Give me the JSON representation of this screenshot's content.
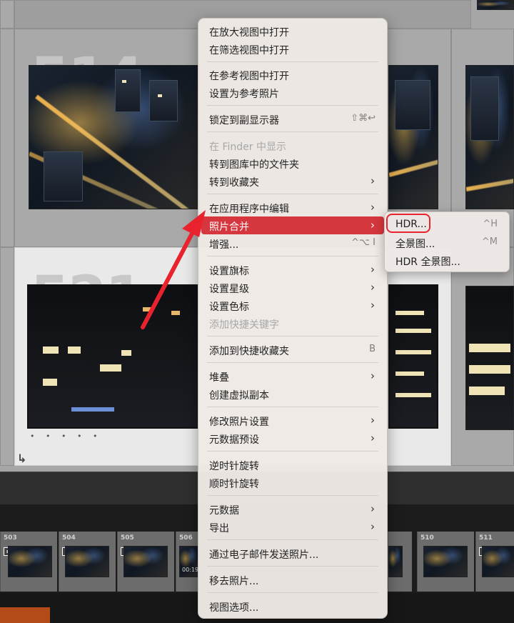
{
  "grid": {
    "cells": [
      {
        "number": "514"
      },
      {
        "number": "521"
      }
    ]
  },
  "filmstrip": {
    "cells": [
      {
        "number": "503"
      },
      {
        "number": "504"
      },
      {
        "number": "505"
      },
      {
        "number": "506",
        "duration": "00:19"
      },
      {
        "number": "510"
      },
      {
        "number": "511"
      }
    ]
  },
  "context_menu": {
    "items": [
      {
        "label": "在放大视图中打开"
      },
      {
        "label": "在筛选视图中打开"
      },
      {
        "label": "在参考视图中打开"
      },
      {
        "label": "设置为参考照片"
      },
      {
        "label": "锁定到副显示器",
        "shortcut": "⇧⌘↩"
      },
      {
        "label": "在 Finder 中显示",
        "disabled": true
      },
      {
        "label": "转到图库中的文件夹"
      },
      {
        "label": "转到收藏夹"
      },
      {
        "label": "在应用程序中编辑"
      },
      {
        "label": "照片合并"
      },
      {
        "label": "增强...",
        "shortcut": "^⌥ I"
      },
      {
        "label": "设置旗标"
      },
      {
        "label": "设置星级"
      },
      {
        "label": "设置色标"
      },
      {
        "label": "添加快捷关键字",
        "disabled": true
      },
      {
        "label": "添加到快捷收藏夹",
        "shortcut": "B"
      },
      {
        "label": "堆叠"
      },
      {
        "label": "创建虚拟副本"
      },
      {
        "label": "修改照片设置"
      },
      {
        "label": "元数据预设"
      },
      {
        "label": "逆时针旋转"
      },
      {
        "label": "顺时针旋转"
      },
      {
        "label": "元数据"
      },
      {
        "label": "导出"
      },
      {
        "label": "通过电子邮件发送照片..."
      },
      {
        "label": "移去照片..."
      },
      {
        "label": "视图选项..."
      }
    ],
    "highlight_color": "#d6363d"
  },
  "submenu": {
    "items": [
      {
        "label": "HDR...",
        "shortcut": "^H"
      },
      {
        "label": "全景图...",
        "shortcut": "^M"
      },
      {
        "label": "HDR 全景图..."
      }
    ]
  },
  "annotation": {
    "color": "#e8232d"
  }
}
